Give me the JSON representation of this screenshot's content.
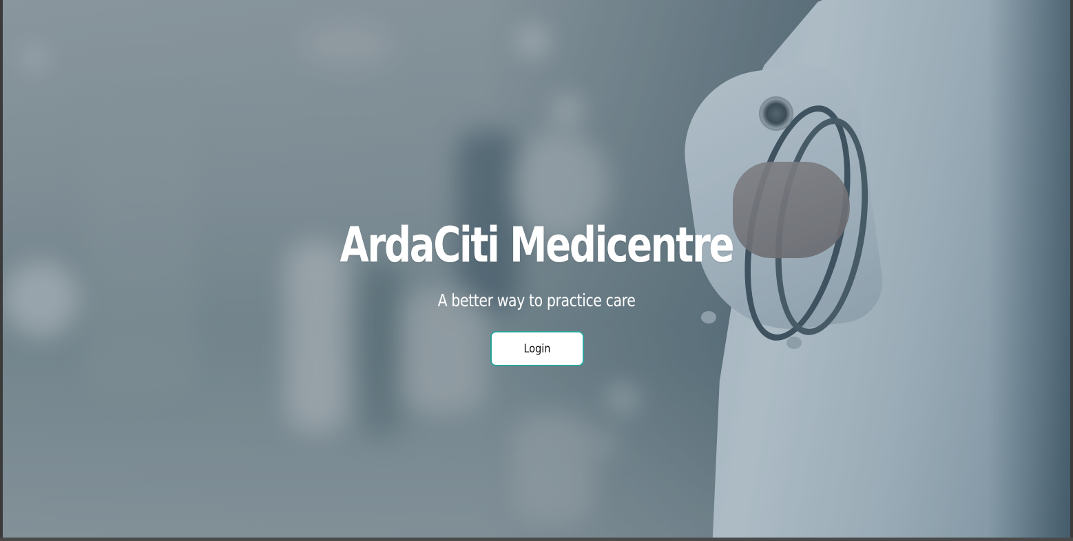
{
  "hero": {
    "title": "ArdaCiti Medicentre",
    "subtitle": "A better way to practice care",
    "login_label": "Login"
  },
  "colors": {
    "button_border": "#2aa39a",
    "button_background": "#ffffff",
    "title_text": "#ffffff"
  },
  "background_image": "blurred hospital corridor with doctor in white coat holding stethoscope"
}
